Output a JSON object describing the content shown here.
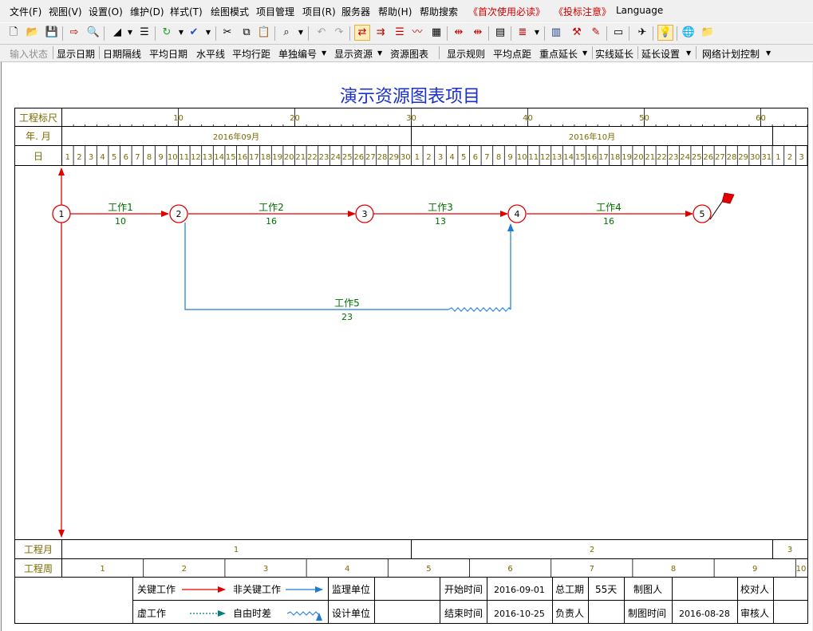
{
  "menu": [
    "文件(F)",
    "视图(V)",
    "设置(O)",
    "维护(D)",
    "样式(T)",
    "绘图模式",
    "项目管理",
    "项目(R)",
    "服务器",
    "帮助(H)",
    "帮助搜索",
    "《首次使用必读》",
    "《投标注意》",
    "Language"
  ],
  "toolbar2": [
    "输入状态",
    "显示日期",
    "日期隔线",
    "平均日期",
    "水平线",
    "平均行距",
    "单独编号",
    "显示资源",
    "资源图表",
    "显示规则",
    "平均点距",
    "重点延长",
    "实线延长",
    "延长设置",
    "网络计划控制"
  ],
  "chart": {
    "title": "演示资源图表项目",
    "scale_label": "工程标尺",
    "ym_label": "年. 月",
    "day_label": "日",
    "scale_ticks": [
      "10",
      "20",
      "30",
      "40",
      "50",
      "60"
    ],
    "months": [
      "2016年09月",
      "2016年10月"
    ],
    "days_sep": [
      "1",
      "2",
      "3",
      "4",
      "5",
      "6",
      "7",
      "8",
      "9",
      "10",
      "11",
      "12",
      "13",
      "14",
      "15",
      "16",
      "17",
      "18",
      "19",
      "20",
      "21",
      "22",
      "23",
      "24",
      "25",
      "26",
      "27",
      "28",
      "29",
      "30"
    ],
    "days_oct": [
      "1",
      "2",
      "3",
      "4",
      "5",
      "6",
      "7",
      "8",
      "9",
      "10",
      "11",
      "12",
      "13",
      "14",
      "15",
      "16",
      "17",
      "18",
      "19",
      "20",
      "21",
      "22",
      "23",
      "24",
      "25",
      "26",
      "27",
      "28",
      "29",
      "30",
      "31"
    ],
    "days_nov": [
      "1",
      "2",
      "3"
    ],
    "nodes": [
      "1",
      "2",
      "3",
      "4",
      "5"
    ],
    "tasks": [
      {
        "name": "工作1",
        "duration": "10"
      },
      {
        "name": "工作2",
        "duration": "16"
      },
      {
        "name": "工作3",
        "duration": "13"
      },
      {
        "name": "工作4",
        "duration": "16"
      },
      {
        "name": "工作5",
        "duration": "23"
      }
    ],
    "month_row_label": "工程月",
    "month_row": [
      "1",
      "2",
      "3"
    ],
    "week_row_label": "工程周",
    "week_row": [
      "1",
      "2",
      "3",
      "4",
      "5",
      "6",
      "7",
      "8",
      "9",
      "10"
    ]
  },
  "legend": {
    "critical": "关键工作",
    "noncritical": "非关键工作",
    "supervisor": "监理单位",
    "dummy": "虚工作",
    "float": "自由时差",
    "designer": "设计单位"
  },
  "info": {
    "start_label": "开始时间",
    "start_value": "2016-09-01",
    "total_label": "总工期",
    "total_value": "55天",
    "drafter_label": "制图人",
    "checker_label": "校对人",
    "end_label": "结束时间",
    "end_value": "2016-10-25",
    "leader_label": "负责人",
    "drawtime_label": "制图时间",
    "drawtime_value": "2016-08-28",
    "reviewer_label": "审核人"
  },
  "colors": {
    "critical": "#e00000",
    "noncritical": "#1e7ad8",
    "float_dummy": "#008080",
    "label": "#007000",
    "title": "#1a30c8",
    "ruler": "#7a6a00"
  }
}
